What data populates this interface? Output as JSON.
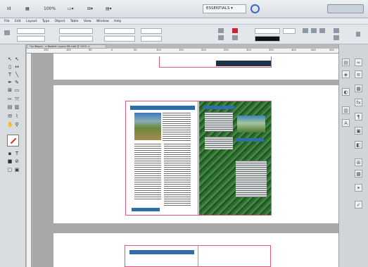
{
  "workspace": {
    "label": "ESSENTIALS",
    "arrow": "▾"
  },
  "menu": [
    "File",
    "Edit",
    "Layout",
    "Type",
    "Object",
    "Table",
    "View",
    "Window",
    "Help"
  ],
  "document_tab": {
    "title": "*Lo Wagon - a Booklet Layout 68.indd @ 100%",
    "close": "×"
  },
  "ruler_ticks": [
    "150",
    "100",
    "50",
    "0",
    "50",
    "100",
    "150",
    "200",
    "250",
    "300",
    "350",
    "400",
    "450",
    "500"
  ],
  "zoom": "100%",
  "colors": {
    "app_bg": "#d7dce2",
    "pasteboard": "#a8a8a8",
    "page_border": "#e05a80",
    "accent_blue": "#4066c0"
  }
}
